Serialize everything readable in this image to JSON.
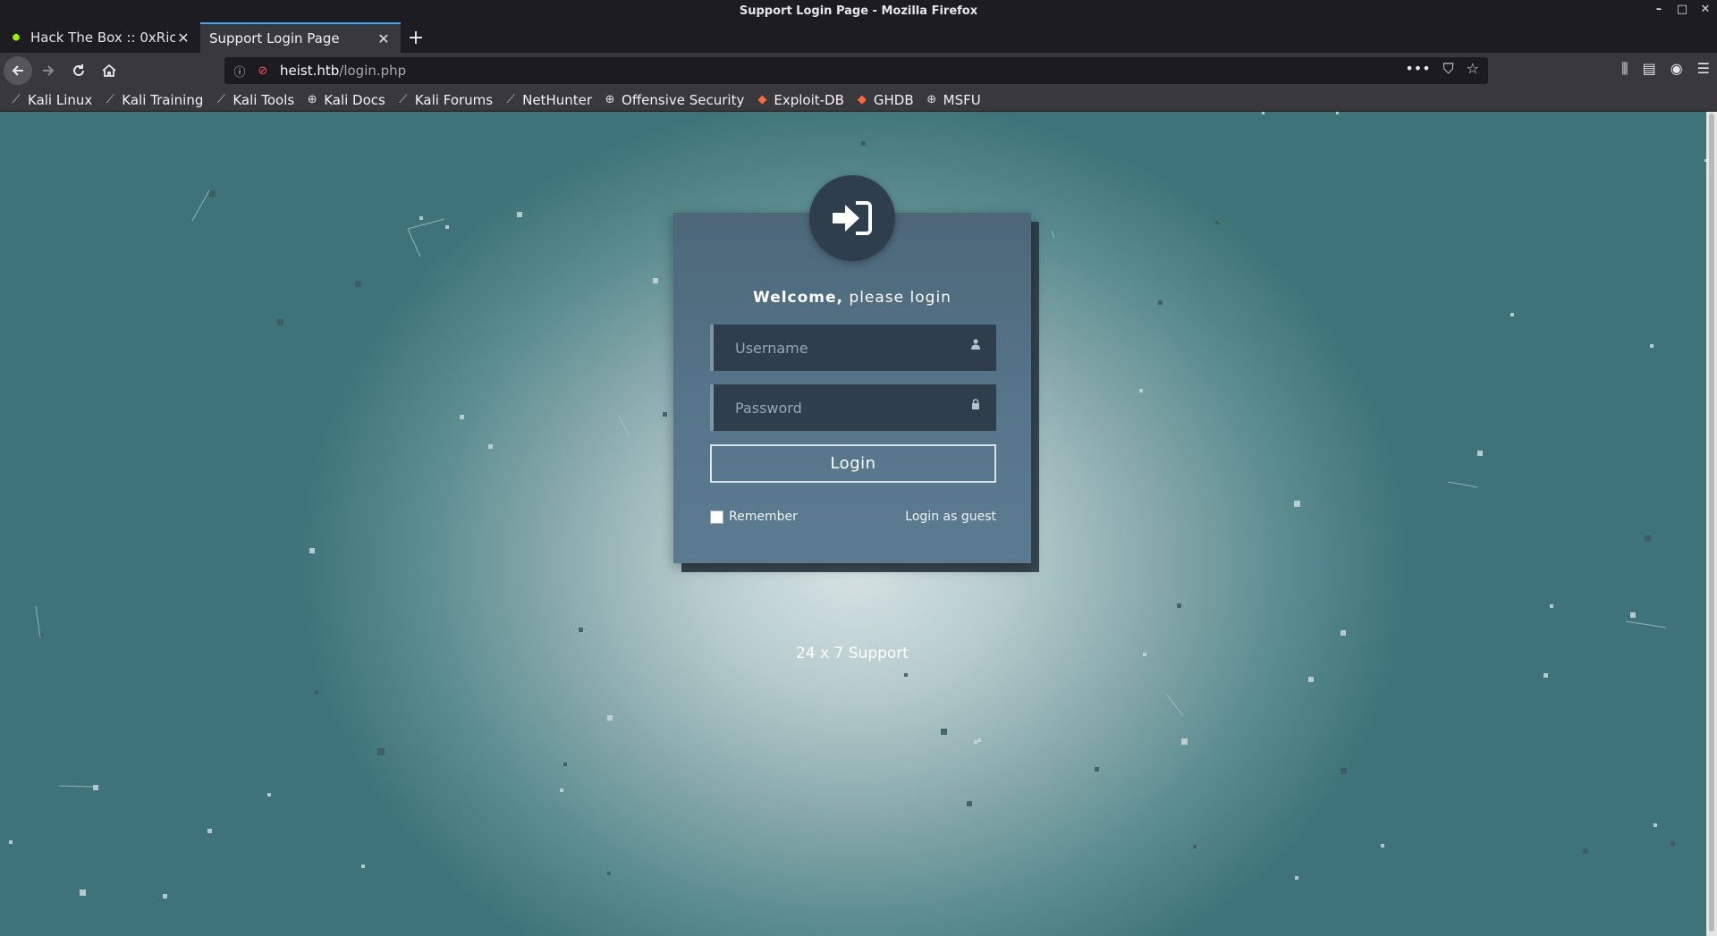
{
  "window": {
    "title": "Support Login Page - Mozilla Firefox",
    "controls": {
      "minimize": "–",
      "maximize": "□",
      "close": "✕"
    }
  },
  "tabs": [
    {
      "title": "Hack The Box :: 0xRick",
      "active": false
    },
    {
      "title": "Support Login Page",
      "active": true
    }
  ],
  "new_tab": "+",
  "url": {
    "host": "heist.htb",
    "path": "/login.php"
  },
  "bookmarks": [
    {
      "label": "Kali Linux",
      "icon": "kali-dragon-icon"
    },
    {
      "label": "Kali Training",
      "icon": "kali-dragon-icon"
    },
    {
      "label": "Kali Tools",
      "icon": "kali-dragon-icon"
    },
    {
      "label": "Kali Docs",
      "icon": "globe-icon"
    },
    {
      "label": "Kali Forums",
      "icon": "kali-dragon-icon"
    },
    {
      "label": "NetHunter",
      "icon": "kali-dragon-icon"
    },
    {
      "label": "Offensive Security",
      "icon": "globe-icon"
    },
    {
      "label": "Exploit-DB",
      "icon": "exploit-icon"
    },
    {
      "label": "GHDB",
      "icon": "exploit-icon"
    },
    {
      "label": "MSFU",
      "icon": "globe-icon"
    }
  ],
  "login": {
    "welcome_bold": "Welcome,",
    "welcome_rest": " please login",
    "username_placeholder": "Username",
    "password_placeholder": "Password",
    "login_button": "Login",
    "remember_label": "Remember",
    "remember_checked": false,
    "guest_link": "Login as guest"
  },
  "footer_text": "24 x 7 Support",
  "colors": {
    "accent_tab": "#45a1ff",
    "card_bg": "#56758a",
    "field_bg": "#2f3e4d",
    "avatar_bg": "#2f3e4d",
    "page_center": "#d6e3e4",
    "page_edge": "#3e7479"
  }
}
